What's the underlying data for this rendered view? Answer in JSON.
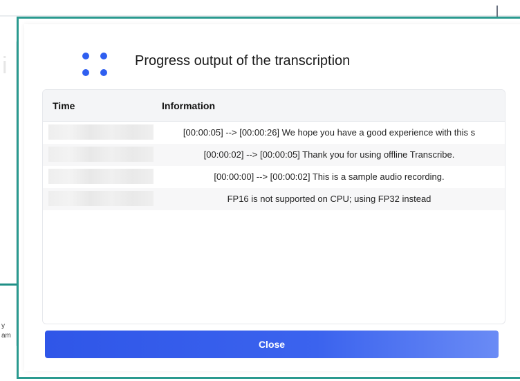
{
  "dialog": {
    "title": "Progress output of the transcription",
    "close_label": "Close",
    "accent_color": "#2f5ff0",
    "frame_color": "#2a9a8f"
  },
  "table": {
    "columns": [
      "Time",
      "Information"
    ],
    "rows": [
      {
        "time": "",
        "info": "[00:00:05] --> [00:00:26]  We hope you have a good experience with this s"
      },
      {
        "time": "",
        "info": "[00:00:02] --> [00:00:05]  Thank you for using offline Transcribe."
      },
      {
        "time": "",
        "info": "[00:00:00] --> [00:00:02]  This is a sample audio recording."
      },
      {
        "time": "",
        "info": "FP16 is not supported on CPU; using FP32 instead"
      }
    ]
  },
  "background": {
    "letter": "i",
    "side_text_1": "y",
    "side_text_2": "am"
  }
}
